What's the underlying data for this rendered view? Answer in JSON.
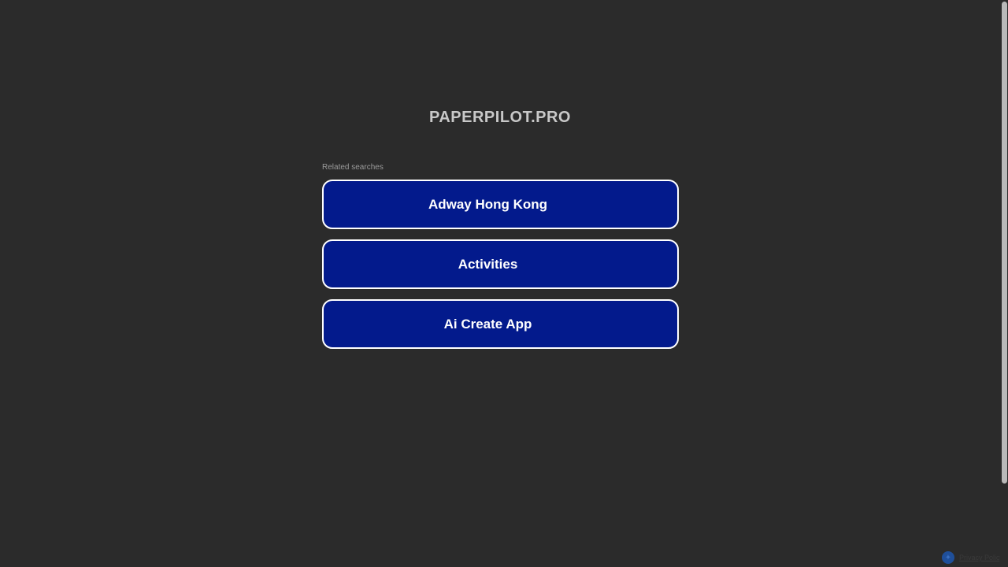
{
  "header": {
    "domain": "PAPERPILOT.PRO"
  },
  "related": {
    "label": "Related searches",
    "items": [
      {
        "label": "Adway Hong Kong"
      },
      {
        "label": "Activities"
      },
      {
        "label": "Ai Create App"
      }
    ]
  },
  "footer": {
    "privacy_icon": "privacy-shield-icon",
    "privacy_label": "Privacy Policy"
  },
  "colors": {
    "background": "#2b2b2b",
    "button_bg": "#031a8c",
    "button_border": "#ffffff",
    "title_text": "#c8c8c8"
  }
}
